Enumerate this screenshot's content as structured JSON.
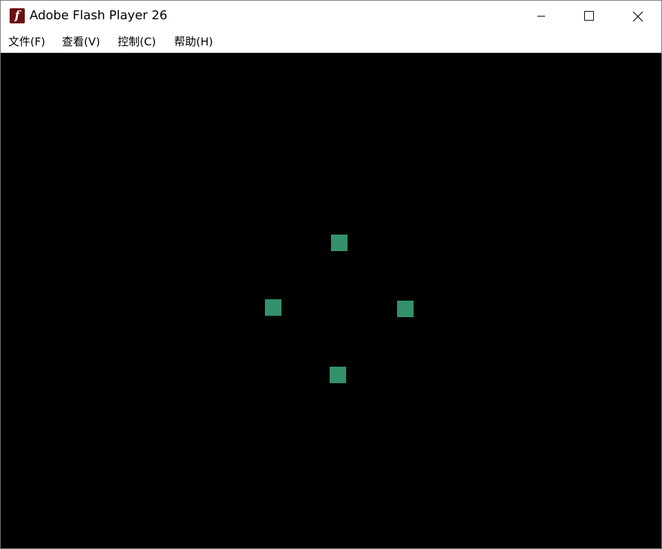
{
  "window": {
    "title": "Adobe Flash Player 26",
    "app_icon_glyph": "f",
    "app_icon_name": "flash-player-icon",
    "controls": {
      "minimize_icon": "minimize-icon",
      "maximize_icon": "maximize-icon",
      "close_icon": "close-icon"
    }
  },
  "menu": {
    "items": [
      {
        "label": "文件(F)"
      },
      {
        "label": "查看(V)"
      },
      {
        "label": "控制(C)"
      },
      {
        "label": "帮助(H)"
      }
    ]
  },
  "stage": {
    "background_color": "#000000",
    "tile_color": "#33916b",
    "tile_count": 4
  }
}
